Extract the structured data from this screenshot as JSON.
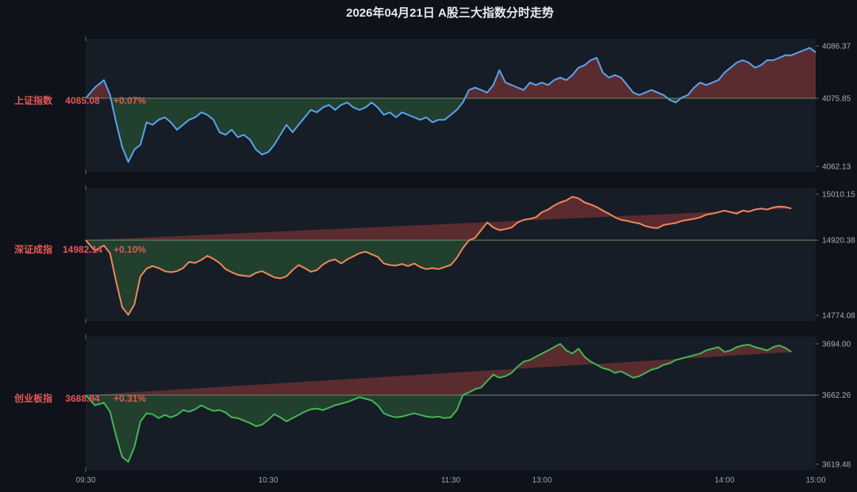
{
  "colors": {
    "background": "#0f121a",
    "panel": "#161d26",
    "baseline": "#6f8a66",
    "up_fill": "#5a2c30",
    "down_fill": "#21402d",
    "label_text": "#e55757",
    "axis_text": "#a5adba"
  },
  "chart_data": [
    {
      "type": "area",
      "title": "2026年04月21日  A股三大指数分时走势",
      "name": "上证指数",
      "last_value_label": "4085.08",
      "change_label": "+0.07%",
      "line_color": "#5aa2f0",
      "x_ticks": [
        "09:30",
        "10:30",
        "11:30",
        "13:00",
        "14:00",
        "15:00"
      ],
      "y_ticks": [
        "4086.37",
        "4075.85",
        "4062.13"
      ],
      "baseline": 4075.85,
      "ylim": [
        4062.13,
        4086.37
      ],
      "x": [
        0,
        3,
        6,
        8,
        10,
        12,
        14,
        16,
        18,
        20,
        22,
        24,
        26,
        28,
        30,
        32,
        34,
        36,
        38,
        40,
        42,
        44,
        46,
        48,
        50,
        52,
        54,
        56,
        58,
        60,
        62,
        64,
        66,
        68,
        70,
        72,
        74,
        76,
        78,
        80,
        82,
        84,
        86,
        88,
        90,
        92,
        94,
        96,
        98,
        100,
        102,
        104,
        106,
        108,
        110,
        112,
        114,
        116,
        118,
        120,
        122,
        124,
        126,
        128,
        130,
        132,
        134,
        136,
        138,
        140,
        142,
        144,
        146,
        148,
        150,
        152,
        154,
        156,
        158,
        160,
        162,
        164,
        166,
        168,
        170,
        172,
        174,
        176,
        178,
        180,
        182,
        184,
        186,
        188,
        190,
        192,
        194,
        196,
        198,
        200,
        202,
        204,
        206,
        208,
        210,
        212,
        214,
        216,
        218,
        220,
        222,
        224,
        226,
        228,
        230,
        232,
        234,
        236,
        238,
        240
      ],
      "y": [
        4075.85,
        4078.0,
        4079.5,
        4076.5,
        4071.0,
        4066.0,
        4063.0,
        4065.5,
        4066.5,
        4071.0,
        4070.5,
        4071.5,
        4072.0,
        4071.0,
        4069.5,
        4070.5,
        4071.5,
        4072.0,
        4073.0,
        4072.5,
        4071.5,
        4069.0,
        4068.5,
        4069.5,
        4068.0,
        4068.5,
        4067.5,
        4065.5,
        4064.5,
        4065.0,
        4066.5,
        4068.5,
        4070.5,
        4069.0,
        4070.5,
        4072.0,
        4073.5,
        4073.0,
        4074.0,
        4074.5,
        4073.5,
        4074.5,
        4075.0,
        4074.0,
        4073.5,
        4074.0,
        4075.0,
        4074.0,
        4072.5,
        4073.0,
        4072.0,
        4073.0,
        4072.5,
        4072.0,
        4071.5,
        4072.0,
        4071.0,
        4071.5,
        4071.5,
        4072.5,
        4073.5,
        4075.0,
        4077.5,
        4078.0,
        4077.5,
        4077.0,
        4078.5,
        4081.5,
        4079.0,
        4078.5,
        4078.0,
        4077.5,
        4079.0,
        4078.5,
        4079.0,
        4078.5,
        4079.5,
        4080.0,
        4079.5,
        4080.5,
        4082.0,
        4082.5,
        4083.5,
        4084.0,
        4081.0,
        4080.0,
        4080.5,
        4080.0,
        4078.5,
        4077.0,
        4076.5,
        4077.0,
        4077.5,
        4077.0,
        4076.5,
        4075.5,
        4075.0,
        4076.0,
        4076.5,
        4078.0,
        4079.0,
        4078.5,
        4079.0,
        4079.5,
        4081.0,
        4082.0,
        4083.0,
        4083.5,
        4083.0,
        4082.0,
        4082.5,
        4083.5,
        4083.5,
        4084.0,
        4084.5,
        4084.5,
        4085.0,
        4085.5,
        4086.0,
        4085.08
      ]
    },
    {
      "type": "area",
      "name": "深证成指",
      "last_value_label": "14982.14",
      "change_label": "+0.10%",
      "line_color": "#f0875a",
      "y_ticks": [
        "15010.15",
        "14920.38",
        "14774.08"
      ],
      "baseline": 14920.38,
      "ylim": [
        14774.08,
        15010.15
      ],
      "x": [
        0,
        3,
        6,
        8,
        10,
        12,
        14,
        16,
        18,
        20,
        22,
        24,
        26,
        28,
        30,
        32,
        34,
        36,
        38,
        40,
        42,
        44,
        46,
        48,
        50,
        52,
        54,
        56,
        58,
        60,
        62,
        64,
        66,
        68,
        70,
        72,
        74,
        76,
        78,
        80,
        82,
        84,
        86,
        88,
        90,
        92,
        94,
        96,
        98,
        100,
        102,
        104,
        106,
        108,
        110,
        112,
        114,
        116,
        118,
        120,
        122,
        124,
        126,
        128,
        130,
        132,
        134,
        136,
        138,
        140,
        142,
        144,
        146,
        148,
        150,
        152,
        154,
        156,
        158,
        160,
        162,
        164,
        166,
        168,
        170,
        172,
        174,
        176,
        178,
        180,
        182,
        184,
        186,
        188,
        190,
        192,
        194,
        196,
        198,
        200,
        202,
        204,
        206,
        208,
        210,
        212,
        214,
        216,
        218,
        220,
        222,
        224,
        226,
        228,
        230,
        232,
        234,
        236,
        238,
        240
      ],
      "y": [
        14920.38,
        14900.0,
        14910.0,
        14895.0,
        14840.0,
        14790.0,
        14775.0,
        14795.0,
        14850.0,
        14865.0,
        14870.0,
        14866.0,
        14860.0,
        14858.0,
        14860.0,
        14866.0,
        14878.0,
        14876.0,
        14882.0,
        14890.0,
        14884.0,
        14876.0,
        14864.0,
        14858.0,
        14853.0,
        14851.0,
        14850.0,
        14857.0,
        14860.0,
        14854.0,
        14848.0,
        14846.0,
        14850.0,
        14862.0,
        14872.0,
        14866.0,
        14859.0,
        14862.0,
        14873.0,
        14880.0,
        14883.0,
        14875.0,
        14883.0,
        14889.0,
        14895.0,
        14898.0,
        14893.0,
        14888.0,
        14875.0,
        14872.0,
        14871.0,
        14874.0,
        14870.0,
        14875.0,
        14868.0,
        14864.0,
        14866.0,
        14864.0,
        14868.0,
        14872.0,
        14886.0,
        14905.0,
        14920.0,
        14925.0,
        14940.0,
        14955.0,
        14945.0,
        14940.0,
        14942.0,
        14945.0,
        14955.0,
        14960.0,
        14962.0,
        14965.0,
        14975.0,
        14980.0,
        14988.0,
        14994.0,
        14998.0,
        15005.0,
        15002.0,
        14994.0,
        14990.0,
        14985.0,
        14978.0,
        14972.0,
        14965.0,
        14960.0,
        14958.0,
        14955.0,
        14953.0,
        14948.0,
        14945.0,
        14944.0,
        14950.0,
        14952.0,
        14954.0,
        14958.0,
        14960.0,
        14962.0,
        14965.0,
        14970.0,
        14972.0,
        14975.0,
        14978.0,
        14975.0,
        14972.0,
        14978.0,
        14976.0,
        14980.0,
        14982.0,
        14980.0,
        14984.0,
        14986.0,
        14985.0,
        14982.14
      ]
    },
    {
      "type": "area",
      "name": "创业板指",
      "last_value_label": "3688.94",
      "change_label": "+0.31%",
      "line_color": "#45b555",
      "y_ticks": [
        "3694.00",
        "3662.26",
        "3619.48"
      ],
      "baseline": 3662.26,
      "ylim": [
        3619.48,
        3694.0
      ],
      "x": [
        0,
        3,
        6,
        8,
        10,
        12,
        14,
        16,
        18,
        20,
        22,
        24,
        26,
        28,
        30,
        32,
        34,
        36,
        38,
        40,
        42,
        44,
        46,
        48,
        50,
        52,
        54,
        56,
        58,
        60,
        62,
        64,
        66,
        68,
        70,
        72,
        74,
        76,
        78,
        80,
        82,
        84,
        86,
        88,
        90,
        92,
        94,
        96,
        98,
        100,
        102,
        104,
        106,
        108,
        110,
        112,
        114,
        116,
        118,
        120,
        122,
        124,
        126,
        128,
        130,
        132,
        134,
        136,
        138,
        140,
        142,
        144,
        146,
        148,
        150,
        152,
        154,
        156,
        158,
        160,
        162,
        164,
        166,
        168,
        170,
        172,
        174,
        176,
        178,
        180,
        182,
        184,
        186,
        188,
        190,
        192,
        194,
        196,
        198,
        200,
        202,
        204,
        206,
        208,
        210,
        212,
        214,
        216,
        218,
        220,
        222,
        224,
        226,
        228,
        230,
        232,
        234,
        236,
        238,
        240
      ],
      "y": [
        3662.26,
        3656.0,
        3657.5,
        3652.0,
        3637.0,
        3624.0,
        3621.0,
        3630.0,
        3646.0,
        3651.0,
        3650.5,
        3648.0,
        3650.0,
        3648.5,
        3650.0,
        3653.0,
        3652.0,
        3653.5,
        3656.0,
        3654.0,
        3652.5,
        3653.0,
        3651.5,
        3648.5,
        3648.0,
        3646.5,
        3645.0,
        3643.0,
        3644.0,
        3647.0,
        3650.5,
        3648.5,
        3646.0,
        3648.0,
        3650.0,
        3652.0,
        3653.5,
        3654.0,
        3653.0,
        3654.5,
        3656.0,
        3657.0,
        3658.0,
        3659.5,
        3661.0,
        3660.0,
        3659.0,
        3656.0,
        3651.0,
        3649.5,
        3648.5,
        3649.0,
        3650.0,
        3651.0,
        3650.0,
        3649.0,
        3648.5,
        3649.0,
        3648.0,
        3648.5,
        3653.0,
        3662.26,
        3664.0,
        3666.0,
        3667.0,
        3671.0,
        3675.0,
        3673.0,
        3674.0,
        3676.0,
        3680.0,
        3683.0,
        3684.0,
        3686.0,
        3688.0,
        3690.0,
        3692.0,
        3694.0,
        3690.0,
        3688.0,
        3691.0,
        3686.0,
        3683.0,
        3681.0,
        3679.0,
        3678.0,
        3676.0,
        3677.0,
        3675.0,
        3673.0,
        3674.0,
        3676.0,
        3678.0,
        3679.0,
        3681.0,
        3682.0,
        3684.0,
        3685.0,
        3686.0,
        3687.0,
        3688.0,
        3690.0,
        3691.0,
        3692.0,
        3689.0,
        3690.0,
        3692.0,
        3693.0,
        3693.5,
        3692.0,
        3691.0,
        3690.0,
        3692.0,
        3693.0,
        3691.5,
        3688.94
      ]
    }
  ]
}
